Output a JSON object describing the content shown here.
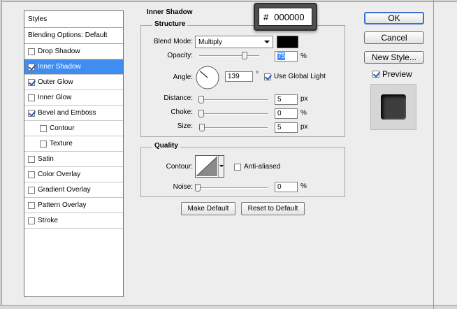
{
  "styles_panel": {
    "header": "Styles",
    "blending_options": "Blending Options: Default",
    "items": [
      {
        "label": "Drop Shadow",
        "checked": false,
        "indent": false,
        "selected": false
      },
      {
        "label": "Inner Shadow",
        "checked": true,
        "indent": false,
        "selected": true
      },
      {
        "label": "Outer Glow",
        "checked": true,
        "indent": false,
        "selected": false
      },
      {
        "label": "Inner Glow",
        "checked": false,
        "indent": false,
        "selected": false
      },
      {
        "label": "Bevel and Emboss",
        "checked": true,
        "indent": false,
        "selected": false
      },
      {
        "label": "Contour",
        "checked": false,
        "indent": true,
        "selected": false
      },
      {
        "label": "Texture",
        "checked": false,
        "indent": true,
        "selected": false
      },
      {
        "label": "Satin",
        "checked": false,
        "indent": false,
        "selected": false
      },
      {
        "label": "Color Overlay",
        "checked": false,
        "indent": false,
        "selected": false
      },
      {
        "label": "Gradient Overlay",
        "checked": false,
        "indent": false,
        "selected": false
      },
      {
        "label": "Pattern Overlay",
        "checked": false,
        "indent": false,
        "selected": false
      },
      {
        "label": "Stroke",
        "checked": false,
        "indent": false,
        "selected": false
      }
    ]
  },
  "inner_shadow": {
    "title": "Inner Shadow",
    "structure": {
      "title": "Structure",
      "blend_mode_label": "Blend Mode:",
      "blend_mode_value": "Multiply",
      "shadow_color": "#000000",
      "opacity_label": "Opacity:",
      "opacity_value": "75",
      "opacity_unit": "%",
      "opacity_fraction": 0.75,
      "angle_label": "Angle:",
      "angle_value": "139",
      "angle_unit": "°",
      "use_global_light_label": "Use Global Light",
      "use_global_light_checked": true,
      "distance_label": "Distance:",
      "distance_value": "5",
      "distance_unit": "px",
      "choke_label": "Choke:",
      "choke_value": "0",
      "choke_unit": "%",
      "size_label": "Size:",
      "size_value": "5",
      "size_unit": "px"
    },
    "quality": {
      "title": "Quality",
      "contour_label": "Contour:",
      "anti_aliased_label": "Anti-aliased",
      "anti_aliased_checked": false,
      "noise_label": "Noise:",
      "noise_value": "0",
      "noise_unit": "%"
    },
    "make_default_label": "Make Default",
    "reset_default_label": "Reset to Default"
  },
  "color_tooltip": {
    "hash": "#",
    "hex": "000000"
  },
  "right_buttons": {
    "ok_label": "OK",
    "cancel_label": "Cancel",
    "new_style_label": "New Style...",
    "preview_label": "Preview",
    "preview_checked": true
  }
}
